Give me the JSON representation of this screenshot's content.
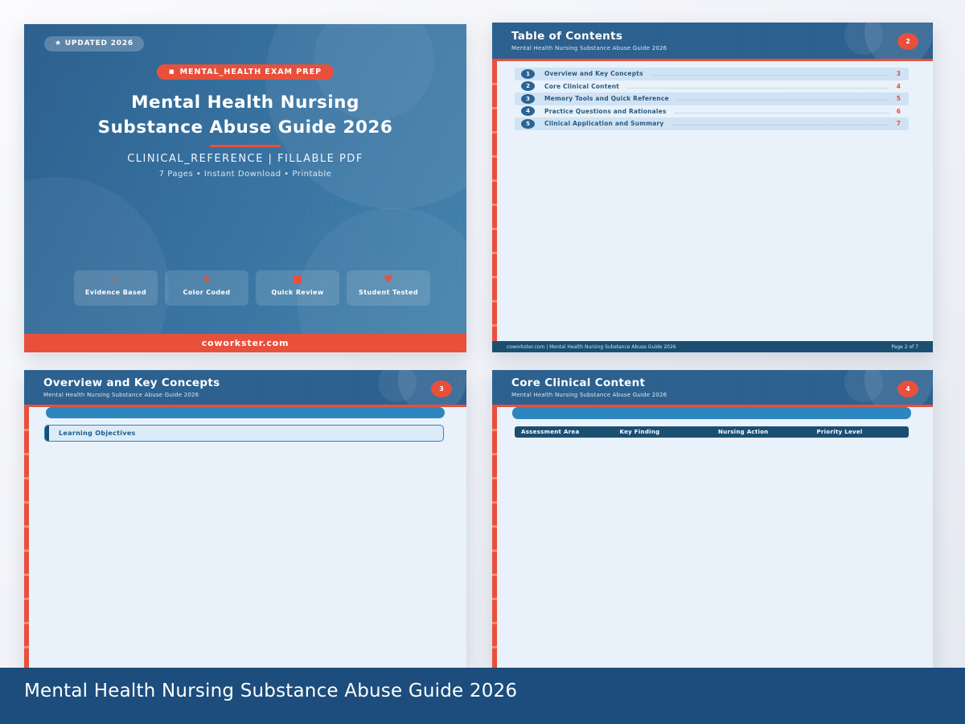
{
  "caption": {
    "text": "Mental Health Nursing Substance Abuse Guide 2026"
  },
  "colors": {
    "accent_red": "#e8503c",
    "header_blue": "#2d6291",
    "navy": "#1b4f72",
    "body_blue": "#e9f2fa",
    "bar_blue": "#2e86c1",
    "caption_navy": "#1c4d7c"
  },
  "cover": {
    "updated_badge": "★ UPDATED 2026",
    "pill_icon": "■",
    "category_pill": "MENTAL_HEALTH EXAM PREP",
    "title_line1": "Mental Health Nursing",
    "title_line2": "Substance Abuse Guide 2026",
    "tagline": "CLINICAL_REFERENCE  |  FILLABLE PDF",
    "meta": "7 Pages  •  Instant Download  •  Printable",
    "features": [
      {
        "icon": "✓",
        "label": "Evidence Based"
      },
      {
        "icon": "★",
        "label": "Color Coded"
      },
      {
        "icon": "■",
        "label": "Quick Review"
      },
      {
        "icon": "♥",
        "label": "Student Tested"
      }
    ],
    "footer": "coworkster.com"
  },
  "toc": {
    "title": "Table of Contents",
    "subtitle": "Mental Health Nursing Substance Abuse Guide 2026",
    "page_badge": "2",
    "entries": [
      {
        "num": "1",
        "label": "Overview and Key Concepts",
        "page": "3"
      },
      {
        "num": "2",
        "label": "Core Clinical Content",
        "page": "4"
      },
      {
        "num": "3",
        "label": "Memory Tools and Quick Reference",
        "page": "5"
      },
      {
        "num": "4",
        "label": "Practice Questions and Rationales",
        "page": "6"
      },
      {
        "num": "5",
        "label": "Clinical Application and Summary",
        "page": "7"
      }
    ],
    "footer_left": "coworkster.com  |  Mental Health Nursing Substance Abuse Guide 2026",
    "footer_right": "Page 2 of 7"
  },
  "overview": {
    "title": "Overview and Key Concepts",
    "subtitle": "Mental Health Nursing Substance Abuse Guide 2026",
    "page_badge": "3",
    "section_label": "Learning Objectives"
  },
  "clinical": {
    "title": "Core Clinical Content",
    "subtitle": "Mental Health Nursing Substance Abuse Guide 2026",
    "page_badge": "4",
    "columns": [
      "Assessment Area",
      "Key Finding",
      "Nursing Action",
      "Priority Level"
    ]
  }
}
